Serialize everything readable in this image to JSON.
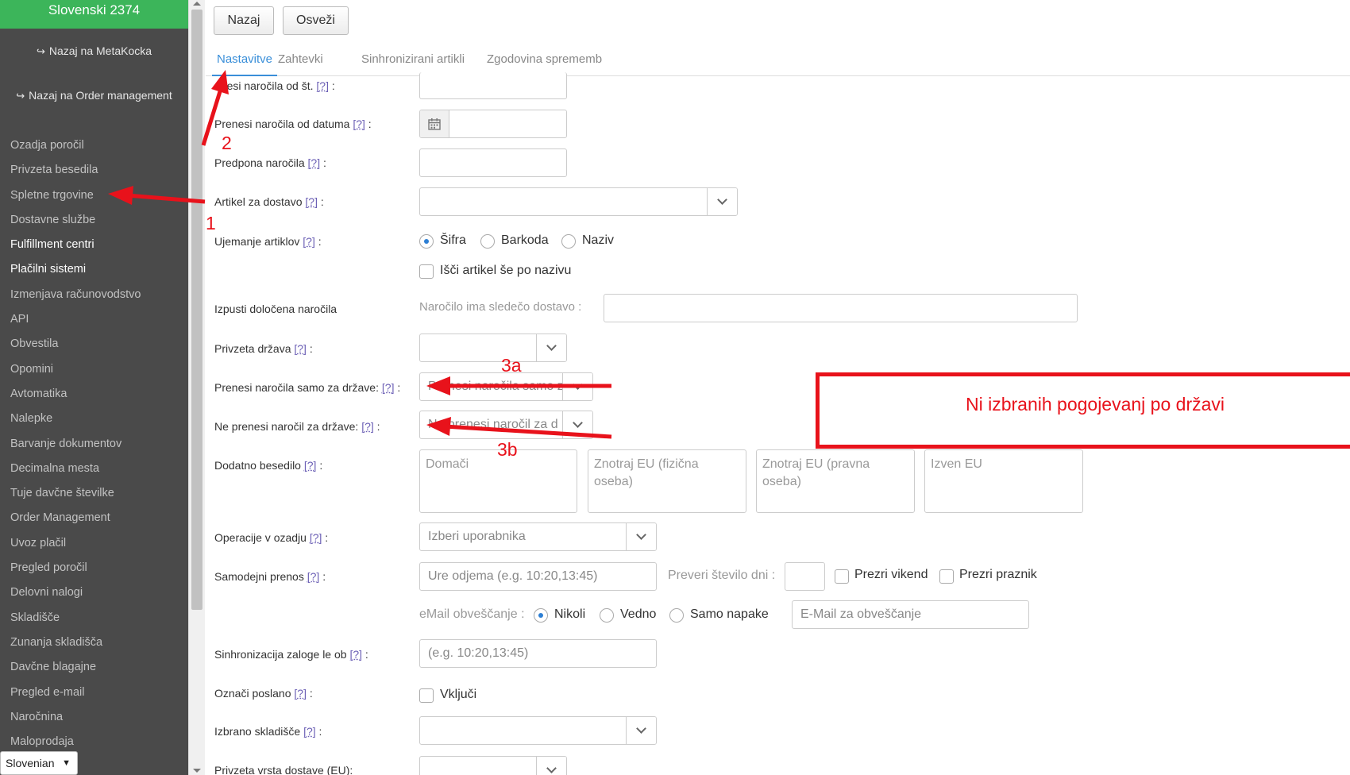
{
  "sidebar": {
    "header_title": "Slovenski 2374",
    "back_metakocka": "Nazaj na MetaKocka",
    "back_order_mgmt": "Nazaj na Order management",
    "items": [
      {
        "label": "Ozadja poročil",
        "bright": false
      },
      {
        "label": "Privzeta besedila",
        "bright": false
      },
      {
        "label": "Spletne trgovine",
        "bright": false
      },
      {
        "label": "Dostavne službe",
        "bright": false
      },
      {
        "label": "Fulfillment centri",
        "bright": true
      },
      {
        "label": "Plačilni sistemi",
        "bright": true
      },
      {
        "label": "Izmenjava računovodstvo",
        "bright": false
      },
      {
        "label": "API",
        "bright": false
      },
      {
        "label": "Obvestila",
        "bright": false
      },
      {
        "label": "Opomini",
        "bright": false
      },
      {
        "label": "Avtomatika",
        "bright": false
      },
      {
        "label": "Nalepke",
        "bright": false
      },
      {
        "label": "Barvanje dokumentov",
        "bright": false
      },
      {
        "label": "Decimalna mesta",
        "bright": false
      },
      {
        "label": "Tuje davčne številke",
        "bright": false
      },
      {
        "label": "Order Management",
        "bright": false
      },
      {
        "label": "Uvoz plačil",
        "bright": false
      },
      {
        "label": "Pregled poročil",
        "bright": false
      },
      {
        "label": "Delovni nalogi",
        "bright": false
      },
      {
        "label": "Skladišče",
        "bright": false
      },
      {
        "label": "Zunanja skladišča",
        "bright": false
      },
      {
        "label": "Davčne blagajne",
        "bright": false
      },
      {
        "label": "Pregled e-mail",
        "bright": false
      },
      {
        "label": "Naročnina",
        "bright": false
      },
      {
        "label": "Maloprodaja",
        "bright": false
      }
    ],
    "language": "Slovenian"
  },
  "toolbar": {
    "back": "Nazaj",
    "refresh": "Osveži"
  },
  "tabs": [
    "Nastavitve",
    "Zahtevki",
    "Sinhronizirani artikli",
    "Zgodovina sprememb"
  ],
  "help_marker": "[?]",
  "form": {
    "orders_from_no": "enesi naročila od št.",
    "orders_from_date": "Prenesi naročila od datuma",
    "order_prefix": "Predpona naročila",
    "delivery_article": "Artikel za dostavo",
    "article_matching": "Ujemanje artiklov",
    "match_options": [
      "Šifra",
      "Barkoda",
      "Naziv"
    ],
    "search_by_name": "Išči artikel še po nazivu",
    "skip_orders": "Izpusti določena naročila",
    "skip_condition": "Naročilo ima sledečo dostavo :",
    "default_country": "Privzeta država",
    "only_countries": "Prenesi naročila samo za države:",
    "only_countries_placeholder": "Prenesi naročila samo z",
    "exclude_countries": "Ne prenesi naročil za države:",
    "exclude_countries_placeholder": "Ne prenesi naročil za d",
    "extra_text": "Dodatno besedilo",
    "extra_text_fields": [
      "Domači",
      "Znotraj EU (fizična oseba)",
      "Znotraj EU (pravna oseba)",
      "Izven EU"
    ],
    "background_ops": "Operacije v ozadju",
    "select_user": "Izberi uporabnika",
    "auto_transfer": "Samodejni prenos",
    "pickup_hours_placeholder": "Ure odjema (e.g. 10:20,13:45)",
    "check_days": "Preveri število dni :",
    "skip_weekend": "Prezri vikend",
    "skip_holiday": "Prezri praznik",
    "email_notify": "eMail obveščanje :",
    "email_options": [
      "Nikoli",
      "Vedno",
      "Samo napake"
    ],
    "email_placeholder": "E-Mail za obveščanje",
    "stock_sync": "Sinhronizacija zaloge le ob",
    "stock_sync_placeholder": "(e.g. 10:20,13:45)",
    "mark_sent": "Označi poslano",
    "include": "Vključi",
    "selected_warehouse": "Izbrano skladišče",
    "default_delivery_eu": "Privzeta vrsta dostave (EU):"
  },
  "annotations": {
    "box_text": "Ni izbranih pogojevanj po državi",
    "n1": "1",
    "n2": "2",
    "n3a": "3a",
    "n3b": "3b",
    "color": "#e8121b"
  },
  "colors": {
    "sidebar_header": "#3cb55a",
    "sidebar_bg": "#4a4a4a",
    "active_tab": "#3a8fd9"
  }
}
